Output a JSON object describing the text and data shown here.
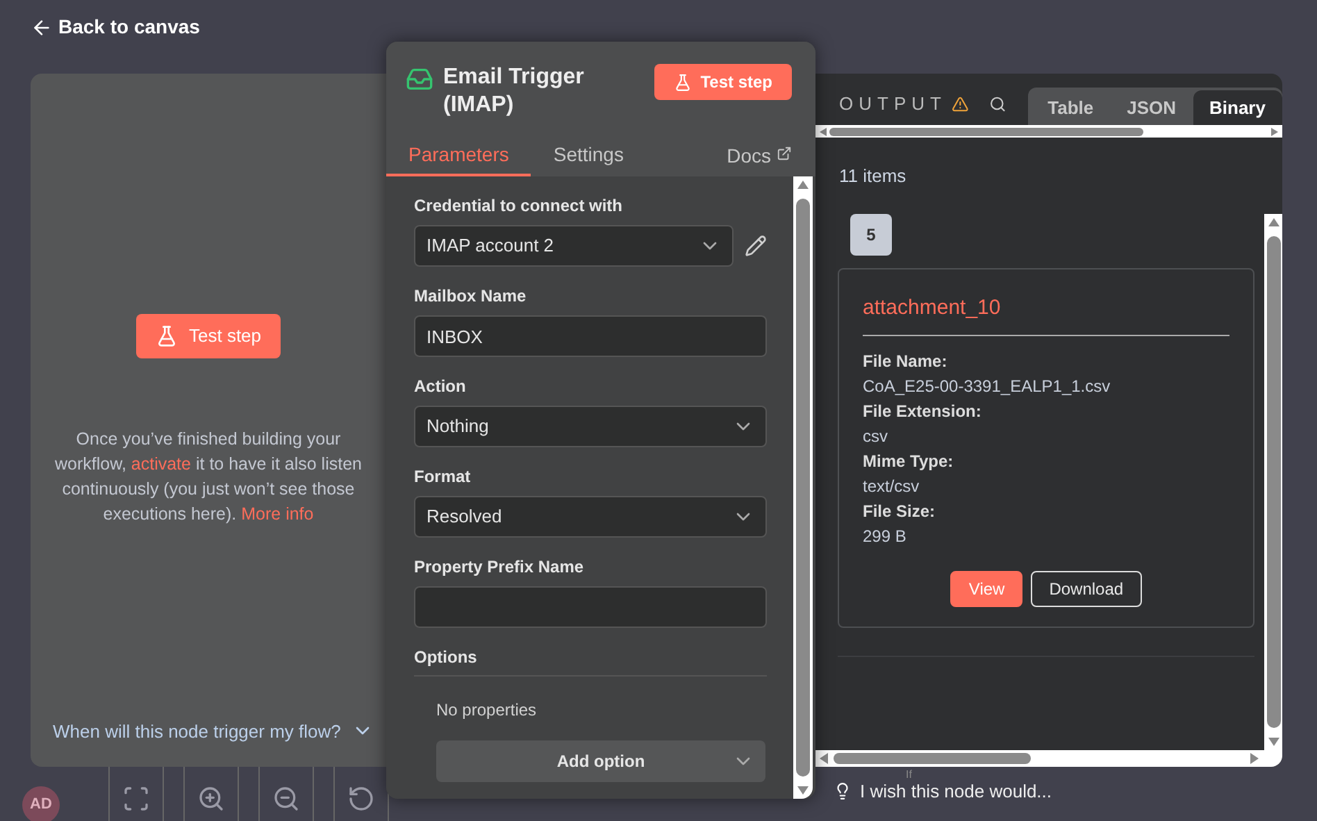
{
  "header": {
    "back_label": "Back to canvas"
  },
  "canvas": {
    "avatar": "AD",
    "toolbar": [
      {
        "kind": "fit"
      },
      {
        "kind": "zoom-in"
      },
      {
        "kind": "zoom-out"
      },
      {
        "kind": "undo"
      }
    ],
    "node_label": "If"
  },
  "input_panel": {
    "test_button": "Test step",
    "message_before": "Once you’ve finished building your workflow, ",
    "link_activate": "activate",
    "message_after": " it to have it also listen continuously (you just won’t see those executions here).",
    "link_more": "More info",
    "footer_question": "When will this node trigger my flow?"
  },
  "node_panel": {
    "title": "Email Trigger (IMAP)",
    "test_button": "Test step",
    "tabs": [
      {
        "label": "Parameters",
        "selected": true
      },
      {
        "label": "Settings",
        "selected": false
      }
    ],
    "docs_link": "Docs",
    "fields": [
      {
        "kind": "select",
        "label": "Credential to connect with",
        "value": "IMAP account 2",
        "editable": true
      },
      {
        "kind": "input",
        "label": "Mailbox Name",
        "value": "INBOX"
      },
      {
        "kind": "select",
        "label": "Action",
        "value": "Nothing"
      },
      {
        "kind": "select",
        "label": "Format",
        "value": "Resolved"
      },
      {
        "kind": "input",
        "label": "Property Prefix Name"
      }
    ],
    "options": {
      "label": "Options",
      "empty_text": "No properties",
      "add_button": "Add option"
    }
  },
  "output_panel": {
    "title": "OUTPUT",
    "views": [
      {
        "label": "Table",
        "selected": false
      },
      {
        "label": "JSON",
        "selected": false
      },
      {
        "label": "Binary",
        "selected": true
      }
    ],
    "item_count": "11 items",
    "item_index": "5",
    "binary": {
      "name": "attachment_10",
      "properties": [
        {
          "label": "File Name:",
          "value": "CoA_E25-00-3391_EALP1_1.csv"
        },
        {
          "label": "File Extension:",
          "value": "csv"
        },
        {
          "label": "Mime Type:",
          "value": "text/csv"
        },
        {
          "label": "File Size:",
          "value": "299 B"
        }
      ],
      "buttons": [
        {
          "label": "View",
          "kind": "primary"
        },
        {
          "label": "Download",
          "kind": "outline"
        }
      ]
    }
  },
  "feedback": {
    "text": "I wish this node would..."
  }
}
